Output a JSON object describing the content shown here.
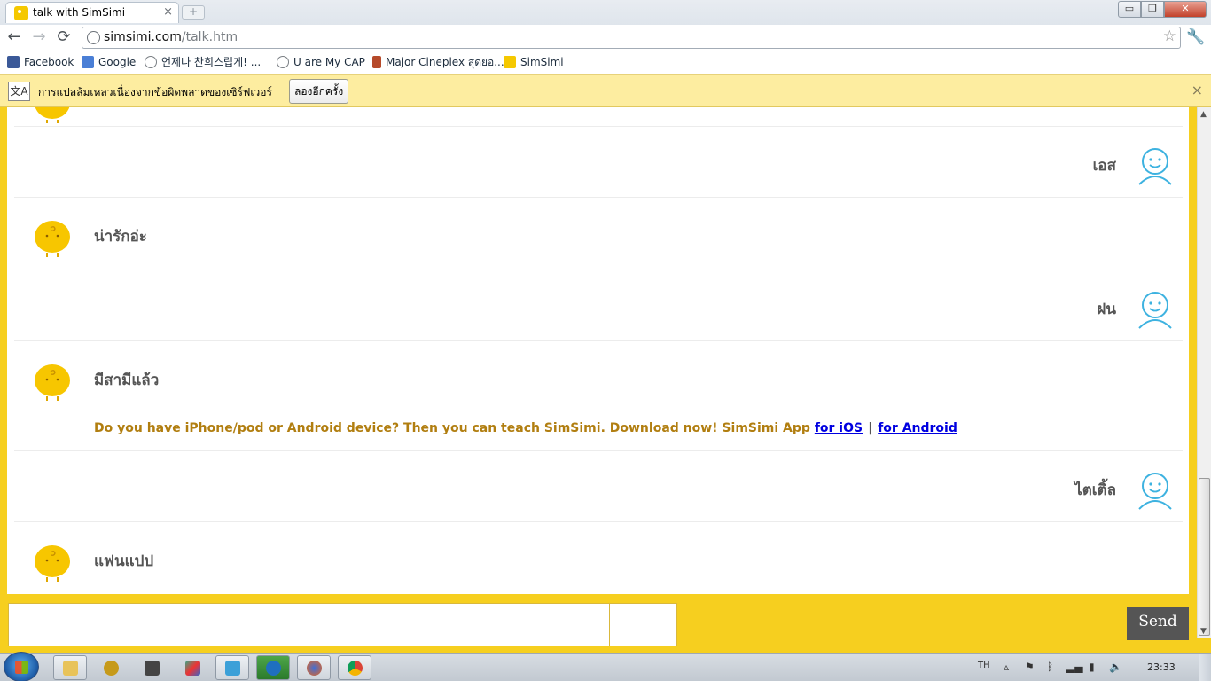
{
  "browser": {
    "tab_title": "talk with SimSimi",
    "tab_close": "×",
    "new_tab": "+",
    "window_min": "▭",
    "window_max": "❐",
    "window_close": "✕",
    "url_host": "simsimi.com",
    "url_path": "/talk.htm",
    "back": "←",
    "forward": "→",
    "reload": "⟳",
    "star": "☆",
    "wrench": "🔧"
  },
  "bookmarks": [
    {
      "label": "Facebook",
      "icon": "facebook-icon",
      "color": "#3b5998"
    },
    {
      "label": "Google",
      "icon": "google-icon",
      "color": "#4a7fd6"
    },
    {
      "label": "언제나 찬희스럽게! ...",
      "icon": "globe-icon",
      "color": "#7a7f84"
    },
    {
      "label": "U are My CAP",
      "icon": "globe-icon",
      "color": "#7a7f84"
    },
    {
      "label": "Major Cineplex สุดยอ...",
      "icon": "cinema-icon",
      "color": "#b64a2a"
    },
    {
      "label": "SimSimi",
      "icon": "simsimi-icon",
      "color": "#f5c800"
    }
  ],
  "translate_bar": {
    "message": "การแปลล้มเหลวเนื่องจากข้อผิดพลาดของเซิร์ฟเวอร์",
    "retry_button": "ลองอีกครั้ง",
    "close": "×"
  },
  "chat": {
    "messages": [
      {
        "from": "user",
        "text": "เอส"
      },
      {
        "from": "bot",
        "text": "น่ารักอ่ะ"
      },
      {
        "from": "user",
        "text": "ฝน"
      },
      {
        "from": "bot",
        "text": "มีสามีแล้ว"
      },
      {
        "from": "user",
        "text": "ไตเติ้ล"
      },
      {
        "from": "bot",
        "text": "แฟนแปป"
      }
    ],
    "ad": {
      "text": "Do you have iPhone/pod or Android device? Then you can teach SimSimi. Download now! SimSimi App ",
      "ios_link": "for iOS",
      "separator": "|",
      "android_link": "for Android"
    }
  },
  "input": {
    "value": "",
    "send_button": "Send"
  },
  "taskbar": {
    "language": "TH",
    "clock": "23:33"
  },
  "colors": {
    "brand_yellow": "#f6cf1f",
    "user_avatar": "#3db2e0",
    "bot_avatar": "#f7c600",
    "link": "#0000e0",
    "ad_text": "#b17e10"
  }
}
